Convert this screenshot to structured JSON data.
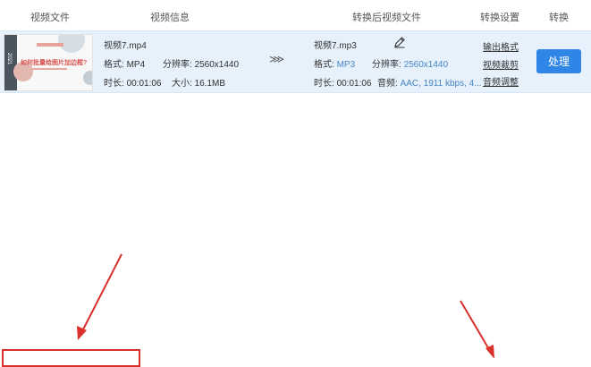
{
  "header": {
    "col_video_file": "视频文件",
    "col_video_info": "视频信息",
    "col_converted_file": "转换后视频文件",
    "col_convert_settings": "转换设置",
    "col_convert": "转换"
  },
  "row": {
    "thumbnail": {
      "year": "2021",
      "title": "如何批量给图片加边框?"
    },
    "source": {
      "filename": "视频7.mp4",
      "format_label": "格式:",
      "format_value": "MP4",
      "resolution_label": "分辨率:",
      "resolution_value": "2560x1440",
      "duration_label": "时长:",
      "duration_value": "00:01:06",
      "size_label": "大小:",
      "size_value": "16.1MB"
    },
    "arrow_glyph": "⋙",
    "target": {
      "filename": "视频7.mp3",
      "format_label": "格式:",
      "format_value": "MP3",
      "resolution_label": "分辨率:",
      "resolution_value": "2560x1440",
      "duration_label": "时长:",
      "duration_value": "00:01:06",
      "audio_label": "音频:",
      "audio_value": "AAC, 1911 kbps, 4..."
    },
    "settings": {
      "output_format": "输出格式",
      "video_trim": "视频裁剪",
      "audio_adjust": "音频调整"
    },
    "process_button": "处理"
  },
  "colors": {
    "row_bg": "#e6f1fb",
    "button_blue": "#2f86e6",
    "annotation_red": "#d9302c",
    "value_blue": "#4a86c5"
  },
  "icons": {
    "edit": "pencil-icon",
    "convert_arrow": "triple-chevron-right-icon"
  }
}
